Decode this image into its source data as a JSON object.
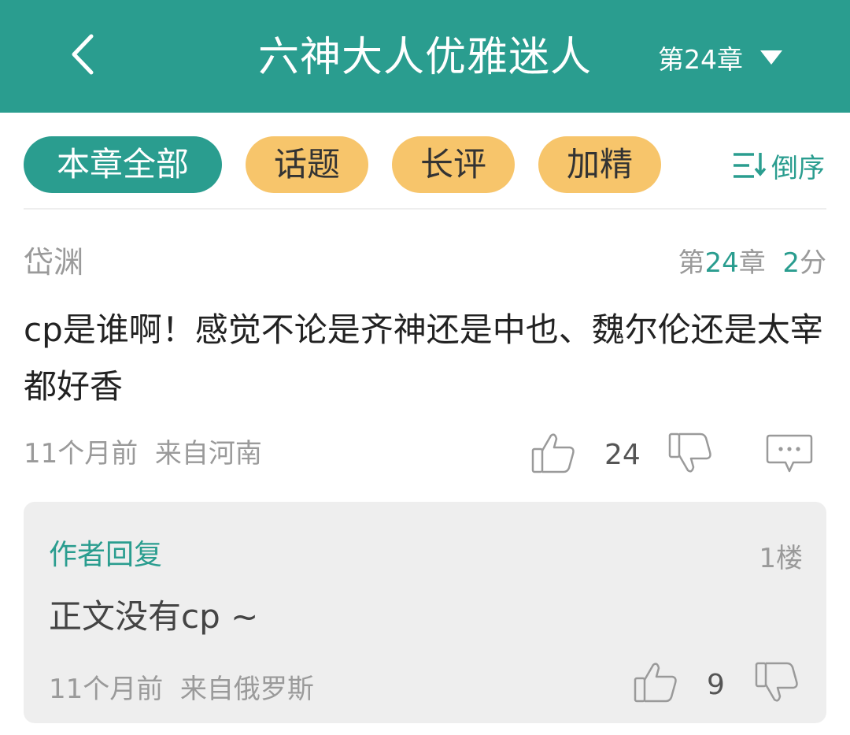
{
  "header": {
    "title": "六神大人优雅迷人",
    "chapter": "第24章"
  },
  "filters": {
    "all": "本章全部",
    "topic": "话题",
    "review": "长评",
    "featured": "加精",
    "sort": "倒序"
  },
  "comment": {
    "user": "岱渊",
    "chapter_prefix": "第",
    "chapter_num": "24",
    "chapter_suffix": "章",
    "score_num": "2",
    "score_suffix": "分",
    "text": "cp是谁啊！感觉不论是齐神还是中也、魏尔伦还是太宰都好香",
    "time": "11个月前  来自河南",
    "likes": "24",
    "reply": {
      "label": "作者回复",
      "floor": "1楼",
      "text": "正文没有cp ~",
      "time": "11个月前  来自俄罗斯",
      "likes": "9"
    }
  },
  "colors": {
    "accent": "#2a9d8f",
    "chip_highlight": "#f7c56b",
    "muted_text": "#9a9a9a"
  },
  "icons": {
    "back": "chevron-left-icon",
    "dropdown": "triangle-down-icon",
    "sort": "sort-icon",
    "like": "thumbs-up-icon",
    "dislike": "thumbs-down-icon",
    "comment": "comment-bubble-icon"
  }
}
